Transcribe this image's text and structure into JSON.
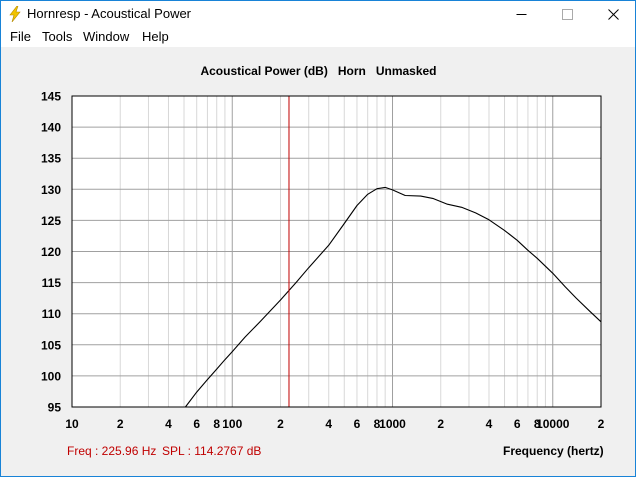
{
  "window": {
    "title": "Hornresp - Acoustical Power",
    "accent_color": "#1883d7",
    "controls": [
      "minimize-icon",
      "maximize-icon",
      "close-icon"
    ]
  },
  "menu": {
    "file": "File",
    "tools": "Tools",
    "window": "Window",
    "help": "Help"
  },
  "chart_data": {
    "type": "line",
    "title": "Acoustical Power (dB)   Horn   Unmasked",
    "xlabel": "Frequency (hertz)",
    "ylabel": "",
    "xscale": "log",
    "xlim": [
      10,
      20000
    ],
    "ylim": [
      95,
      145
    ],
    "grid": true,
    "x_tick_labels": [
      {
        "f": 10,
        "label": "10"
      },
      {
        "f": 20,
        "label": "2"
      },
      {
        "f": 40,
        "label": "4"
      },
      {
        "f": 60,
        "label": "6"
      },
      {
        "f": 80,
        "label": "8"
      },
      {
        "f": 100,
        "label": "100"
      },
      {
        "f": 200,
        "label": "2"
      },
      {
        "f": 400,
        "label": "4"
      },
      {
        "f": 600,
        "label": "6"
      },
      {
        "f": 800,
        "label": "8"
      },
      {
        "f": 1000,
        "label": "1000"
      },
      {
        "f": 2000,
        "label": "2"
      },
      {
        "f": 4000,
        "label": "4"
      },
      {
        "f": 6000,
        "label": "6"
      },
      {
        "f": 8000,
        "label": "8"
      },
      {
        "f": 10000,
        "label": "10000"
      },
      {
        "f": 20000,
        "label": "2"
      }
    ],
    "y_ticks": [
      95,
      100,
      105,
      110,
      115,
      120,
      125,
      130,
      135,
      140,
      145
    ],
    "series": [
      {
        "color": "#000000",
        "x": [
          51,
          60,
          70,
          80,
          90,
          100,
          120,
          150,
          200,
          250,
          300,
          400,
          500,
          600,
          700,
          800,
          900,
          1000,
          1200,
          1500,
          1800,
          2200,
          2700,
          3300,
          4000,
          5000,
          6000,
          7000,
          8000,
          10000,
          12000,
          14000,
          17000,
          20000
        ],
        "y": [
          95,
          97.4,
          99.4,
          101.1,
          102.6,
          103.9,
          106.2,
          108.8,
          112.2,
          115.0,
          117.4,
          121.0,
          124.5,
          127.4,
          129.2,
          130.1,
          130.3,
          129.9,
          129.0,
          128.9,
          128.5,
          127.6,
          127.1,
          126.2,
          125.1,
          123.4,
          121.8,
          120.2,
          118.9,
          116.5,
          114.3,
          112.5,
          110.4,
          108.7
        ]
      }
    ],
    "cursor": {
      "x": 225.96,
      "color": "#c00000"
    },
    "readout": {
      "freq": "Freq : 225.96 Hz",
      "spl": "SPL : 114.2767 dB",
      "color": "#c00000"
    }
  }
}
